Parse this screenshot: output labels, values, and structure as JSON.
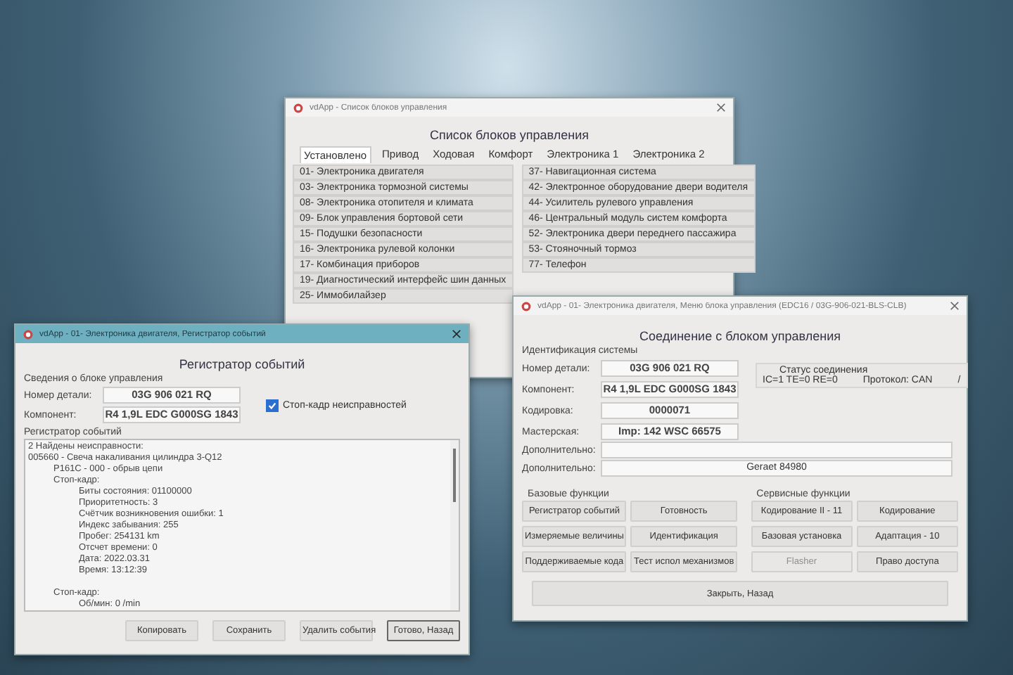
{
  "modules_window": {
    "title": "vdApp - Список блоков управления",
    "heading": "Список блоков управления",
    "tabs": [
      {
        "label": "Установлено",
        "selected": true
      },
      {
        "label": "Привод",
        "selected": false
      },
      {
        "label": "Ходовая",
        "selected": false
      },
      {
        "label": "Комфорт",
        "selected": false
      },
      {
        "label": "Электроника 1",
        "selected": false
      },
      {
        "label": "Электроника 2",
        "selected": false
      }
    ],
    "left_items": [
      "01- Электроника двигателя",
      "03- Электроника тормозной системы",
      "08- Электроника отопителя и климата",
      "09- Блок управления бортовой сети",
      "15- Подушки безопасности",
      "16- Электроника рулевой колонки",
      "17- Комбинация приборов",
      "19- Диагностический интерфейс шин данных",
      "25- Иммобилайзер"
    ],
    "right_items": [
      "37- Навигационная система",
      "42- Электронное оборудование двери водителя",
      "44- Усилитель рулевого управления",
      "46- Центральный модуль систем комфорта",
      "52- Электроника двери переднего пассажира",
      "53- Стояночный тормоз",
      "77- Телефон"
    ]
  },
  "event_window": {
    "title": "vdApp - 01- Электроника двигателя, Регистратор событий",
    "heading": "Регистратор событий",
    "group_label": "Сведения о блоке управления",
    "fields": [
      {
        "label": "Номер детали:",
        "value": "03G 906 021 RQ"
      },
      {
        "label": "Компонент:",
        "value": "R4 1,9L EDC G000SG  1843"
      }
    ],
    "freeze_frame": {
      "label": "Стоп-кадр неисправностей",
      "checked": true
    },
    "log_label": "Регистратор событий",
    "log": [
      {
        "text": "2 Найдены неисправности:"
      },
      {
        "text": "005660 - Свеча накаливания цилиндра 3-Q12",
        "children": [
          {
            "text": "P161C - 000 - обрыв цепи"
          },
          {
            "text": "Стоп-кадр:",
            "children": [
              {
                "text": "Биты состояния: 01100000"
              },
              {
                "text": "Приоритетность: 3"
              },
              {
                "text": "Счётчик возникновения ошибки: 1"
              },
              {
                "text": "Индекс забывания: 255"
              },
              {
                "text": "Пробег: 254131 km"
              },
              {
                "text": "Отсчет времени: 0"
              },
              {
                "text": "Дата: 2022.03.31"
              },
              {
                "text": "Время: 13:12:39"
              }
            ]
          }
        ]
      },
      {
        "children": [
          {
            "text": "Стоп-кадр:",
            "children": [
              {
                "text": "Об/мин: 0 /min"
              }
            ]
          }
        ]
      }
    ],
    "buttons": [
      "Копировать",
      "Сохранить",
      "Удалить события",
      "Готово, Назад"
    ]
  },
  "control_window": {
    "title": "vdApp - 01- Электроника двигателя, Меню блока управления (EDC16 / 03G-906-021-BLS-CLB)",
    "heading": "Соединение с блоком управления",
    "id_label": "Идентификация системы",
    "fields": [
      {
        "label": "Номер детали:",
        "value": "03G 906 021 RQ"
      },
      {
        "label": "Компонент:",
        "value": "R4 1,9L EDC G000SG  1843"
      },
      {
        "label": "Кодировка:",
        "value": "0000071"
      },
      {
        "label": "Мастерская:",
        "value": "Imp: 142     WSC 66575"
      }
    ],
    "extra_fields": [
      {
        "label": "Дополнительно:"
      },
      {
        "label": "Дополнительно:",
        "value": "Geraet 84980"
      }
    ],
    "status": {
      "label": "Статус соединения",
      "codes": "IC=1  TE=0  RE=0",
      "protocol": "Протокол: CAN",
      "spinner": "/"
    },
    "basic_label": "Базовые функции",
    "service_label": "Сервисные функции",
    "basic_buttons": [
      {
        "label": "Регистратор событий",
        "disabled": false
      },
      {
        "label": "Готовность",
        "disabled": false
      },
      {
        "label": "Измеряемые величины",
        "disabled": false
      },
      {
        "label": "Идентификация",
        "disabled": false
      },
      {
        "label": "Поддерживаемые кода",
        "disabled": false
      },
      {
        "label": "Тест испол механизмов",
        "disabled": false
      }
    ],
    "service_buttons": [
      {
        "label": "Кодирование II - 11",
        "disabled": false
      },
      {
        "label": "Кодирование",
        "disabled": false
      },
      {
        "label": "Базовая установка",
        "disabled": false
      },
      {
        "label": "Адаптация - 10",
        "disabled": false
      },
      {
        "label": "Flasher",
        "disabled": true
      },
      {
        "label": "Право доступа",
        "disabled": false
      }
    ],
    "close_button": "Закрыть, Назад"
  }
}
